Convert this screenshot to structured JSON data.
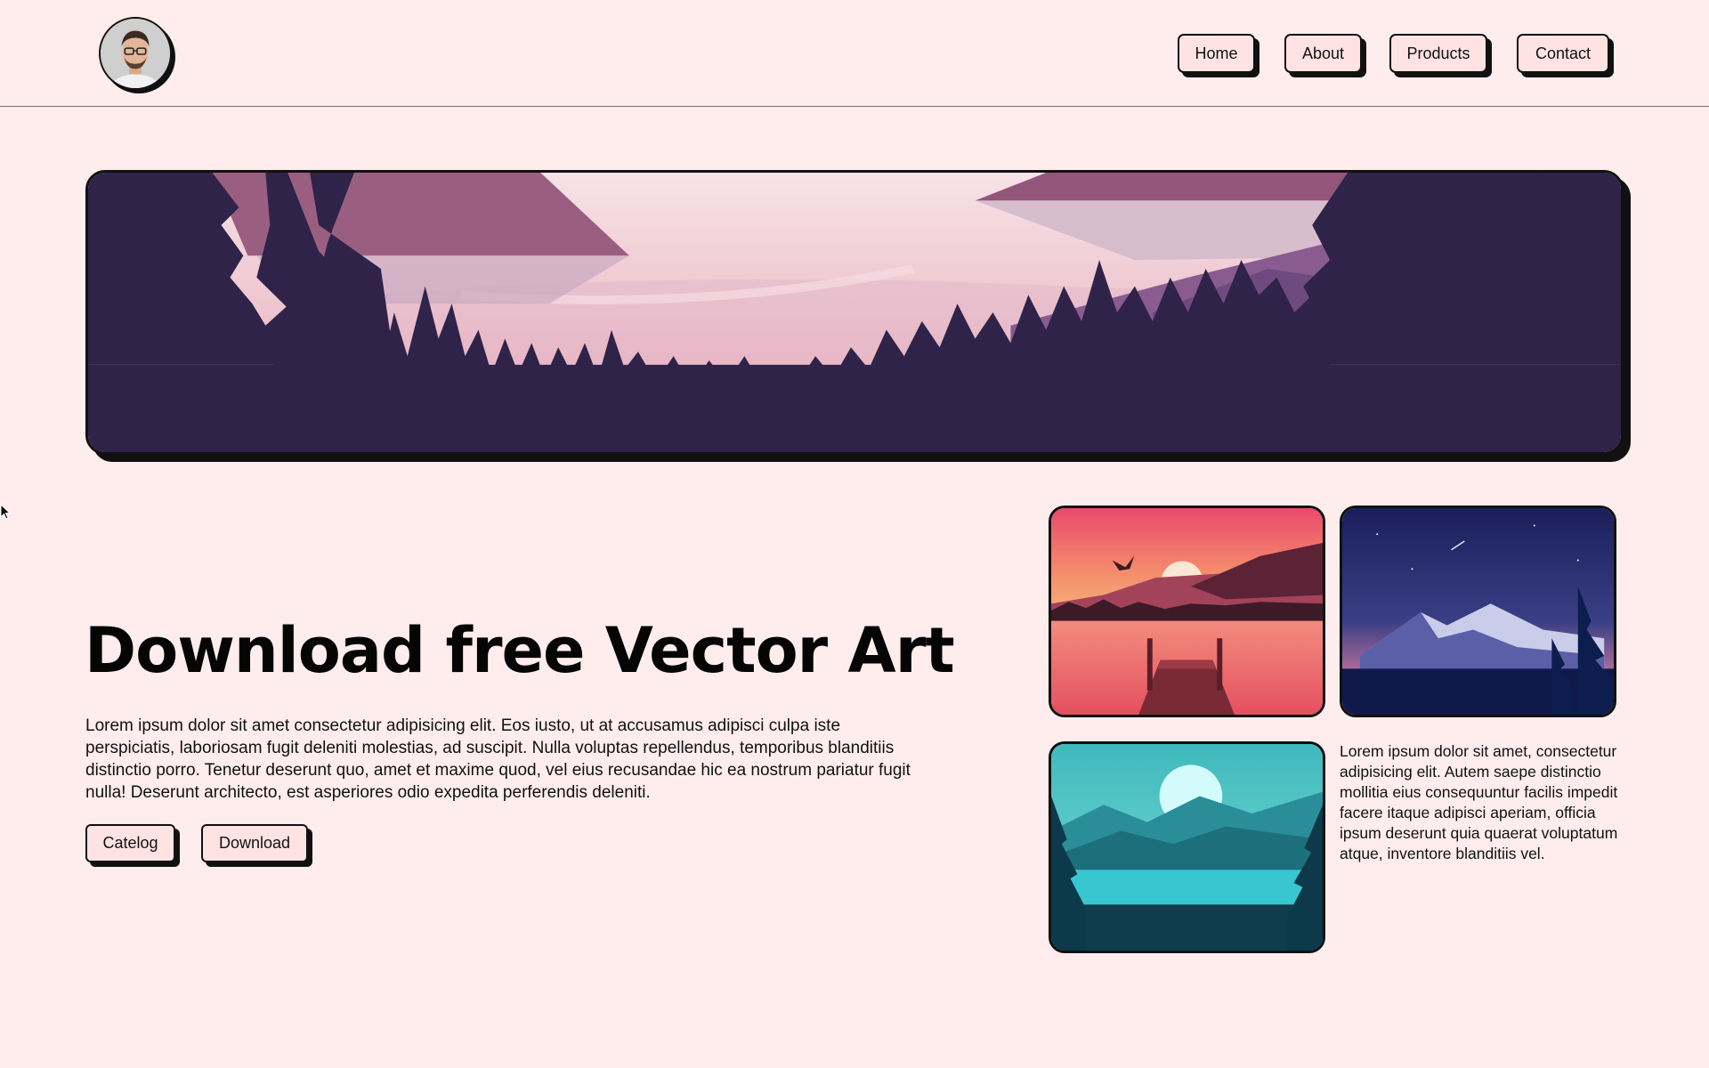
{
  "header": {
    "avatar_icon": "user-avatar-portrait",
    "nav": {
      "home": "Home",
      "about": "About",
      "products": "Products",
      "contact": "Contact"
    }
  },
  "hero": {
    "illustration": "forest-lake-mountains-dusk"
  },
  "main": {
    "headline": "Download free Vector Art",
    "body": "Lorem ipsum dolor sit amet consectetur adipisicing elit. Eos iusto, ut at accusamus adipisci culpa iste perspiciatis, laboriosam fugit deleniti molestias, ad suscipit. Nulla voluptas repellendus, temporibus blanditiis distinctio porro. Tenetur deserunt quo, amet et maxime quod, vel eius recusandae hic ea nostrum pariatur fugit nulla! Deserunt architecto, est asperiores odio expedita perferendis deleniti.",
    "buttons": {
      "catelog": "Catelog",
      "download": "Download"
    }
  },
  "gallery": {
    "tiles": [
      {
        "name": "sunset-pier-lake"
      },
      {
        "name": "night-mountains-deer"
      },
      {
        "name": "teal-moon-lake"
      }
    ],
    "side_text": "Lorem ipsum dolor sit amet, consectetur adipisicing elit. Autem saepe distinctio mollitia eius consequuntur facilis impedit facere itaque adipisci aperiam, officia ipsum deserunt quia quaerat voluptatum atque, inventore blanditiis vel."
  },
  "colors": {
    "page_bg": "#FFEDED",
    "button_bg": "#FFE3E3",
    "border": "#111111",
    "hero_dark": "#2F2349"
  }
}
